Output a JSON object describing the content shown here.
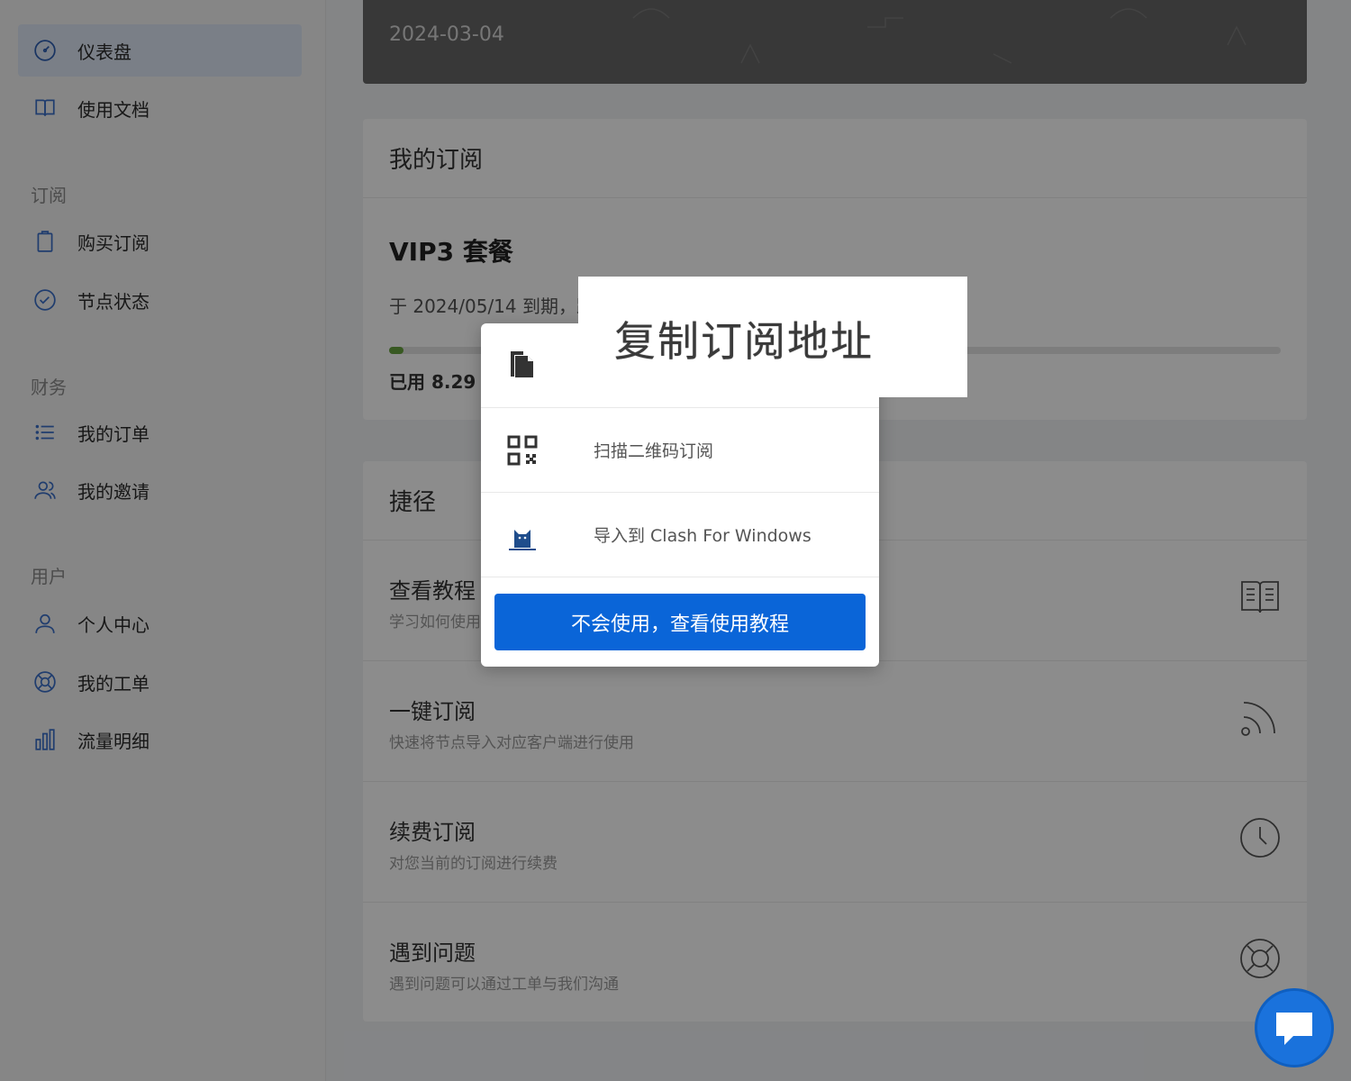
{
  "sidebar": {
    "items": [
      {
        "label": "仪表盘",
        "icon": "dashboard-icon"
      },
      {
        "label": "使用文档",
        "icon": "book-icon"
      },
      {
        "label": "购买订阅",
        "icon": "clipboard-icon"
      },
      {
        "label": "节点状态",
        "icon": "check-circle-icon"
      },
      {
        "label": "我的订单",
        "icon": "list-icon"
      },
      {
        "label": "我的邀请",
        "icon": "users-icon"
      },
      {
        "label": "个人中心",
        "icon": "user-icon"
      },
      {
        "label": "我的工单",
        "icon": "lifebuoy-icon"
      },
      {
        "label": "流量明细",
        "icon": "bar-chart-icon"
      }
    ],
    "sections": {
      "subscription": "订阅",
      "finance": "财务",
      "user": "用户"
    }
  },
  "hero": {
    "date": "2024-03-04"
  },
  "subscription_card": {
    "header": "我的订阅",
    "plan_title": "VIP3 套餐",
    "expire_text": "于 2024/05/14 到期，距",
    "usage_text": "已用 8.29 G",
    "usage_fraction": 0.016
  },
  "shortcuts": {
    "header": "捷径",
    "items": [
      {
        "title": "查看教程",
        "desc": "学习如何使用",
        "icon": "book-open-icon"
      },
      {
        "title": "一键订阅",
        "desc": "快速将节点导入对应客户端进行使用",
        "icon": "rss-icon"
      },
      {
        "title": "续费订阅",
        "desc": "对您当前的订阅进行续费",
        "icon": "clock-icon"
      },
      {
        "title": "遇到问题",
        "desc": "遇到问题可以通过工单与我们沟通",
        "icon": "lifebuoy-icon"
      }
    ]
  },
  "dropdown": {
    "tooltip": "复制订阅地址",
    "items": [
      {
        "label": "",
        "icon": "copy-icon"
      },
      {
        "label": "扫描二维码订阅",
        "icon": "qrcode-icon"
      },
      {
        "label": "导入到 Clash For Windows",
        "icon": "clash-cat-icon"
      }
    ],
    "button": "不会使用，查看使用教程"
  },
  "colors": {
    "accent": "#0a65d8",
    "progress": "#67a33f"
  }
}
